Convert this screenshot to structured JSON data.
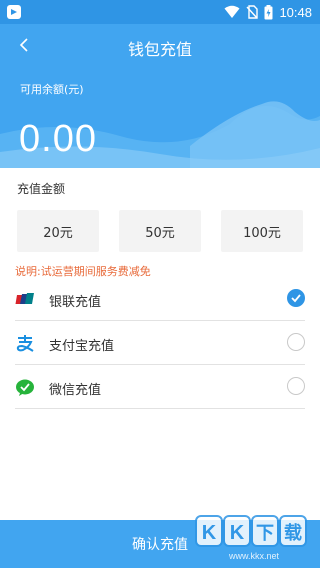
{
  "status_bar": {
    "time": "10:48"
  },
  "header": {
    "title": "钱包充值",
    "balance_label": "可用余额(元)",
    "balance_value": "0.00"
  },
  "recharge": {
    "section_label": "充值金额",
    "amounts": [
      "20元",
      "50元",
      "100元"
    ]
  },
  "note": "说明:试运营期间服务费减免",
  "payment_methods": [
    {
      "label": "银联充值",
      "icon": "unionpay-icon",
      "selected": true
    },
    {
      "label": "支付宝充值",
      "icon": "alipay-icon",
      "selected": false
    },
    {
      "label": "微信充值",
      "icon": "wechat-icon",
      "selected": false
    }
  ],
  "confirm_button": "确认充值",
  "watermark": {
    "text": "KK下载",
    "url": "www.kkx.net"
  },
  "colors": {
    "primary": "#41a5f0",
    "status_bar": "#2f95e5",
    "note": "#e86a3a"
  }
}
